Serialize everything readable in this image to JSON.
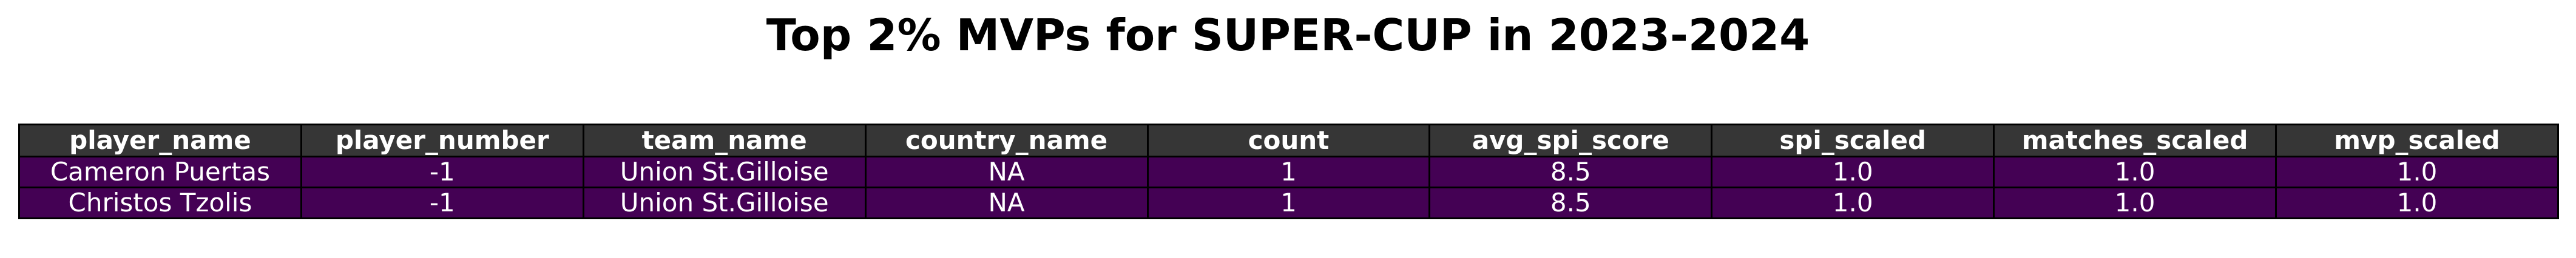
{
  "chart_data": {
    "type": "table",
    "title": "Top 2% MVPs for SUPER-CUP in 2023-2024",
    "columns": [
      "player_name",
      "player_number",
      "team_name",
      "country_name",
      "count",
      "avg_spi_score",
      "spi_scaled",
      "matches_scaled",
      "mvp_scaled"
    ],
    "rows": [
      [
        "Cameron Puertas",
        "-1",
        "Union St.Gilloise",
        "NA",
        "1",
        "8.5",
        "1.0",
        "1.0",
        "1.0"
      ],
      [
        "Christos Tzolis",
        "-1",
        "Union St.Gilloise",
        "NA",
        "1",
        "8.5",
        "1.0",
        "1.0",
        "1.0"
      ]
    ],
    "colors": {
      "header_bg": "#363636",
      "row_bg": "#440154",
      "text": "#ffffff",
      "border": "#000000",
      "title": "#000000"
    }
  }
}
